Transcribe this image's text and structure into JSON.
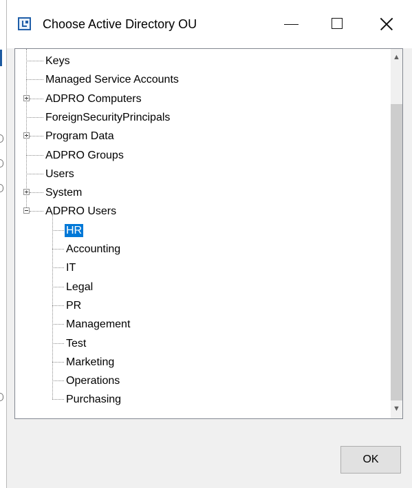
{
  "window": {
    "title": "Choose Active Directory OU",
    "icon": "directory-tree-icon"
  },
  "tree": {
    "nodes": [
      {
        "label": "Keys",
        "level": 0,
        "expander": "none"
      },
      {
        "label": "Managed Service Accounts",
        "level": 0,
        "expander": "none"
      },
      {
        "label": "ADPRO Computers",
        "level": 0,
        "expander": "collapsed"
      },
      {
        "label": "ForeignSecurityPrincipals",
        "level": 0,
        "expander": "none"
      },
      {
        "label": "Program Data",
        "level": 0,
        "expander": "collapsed"
      },
      {
        "label": "ADPRO Groups",
        "level": 0,
        "expander": "none"
      },
      {
        "label": "Users",
        "level": 0,
        "expander": "none"
      },
      {
        "label": "System",
        "level": 0,
        "expander": "collapsed"
      },
      {
        "label": "ADPRO Users",
        "level": 0,
        "expander": "expanded"
      },
      {
        "label": "HR",
        "level": 1,
        "expander": "none",
        "selected": true
      },
      {
        "label": "Accounting",
        "level": 1,
        "expander": "none"
      },
      {
        "label": "IT",
        "level": 1,
        "expander": "none"
      },
      {
        "label": "Legal",
        "level": 1,
        "expander": "none"
      },
      {
        "label": "PR",
        "level": 1,
        "expander": "none"
      },
      {
        "label": "Management",
        "level": 1,
        "expander": "none"
      },
      {
        "label": "Test",
        "level": 1,
        "expander": "none"
      },
      {
        "label": "Marketing",
        "level": 1,
        "expander": "none"
      },
      {
        "label": "Operations",
        "level": 1,
        "expander": "none"
      },
      {
        "label": "Purchasing",
        "level": 1,
        "expander": "none"
      }
    ],
    "selected_color": "#0078d7"
  },
  "buttons": {
    "ok_label": "OK"
  }
}
